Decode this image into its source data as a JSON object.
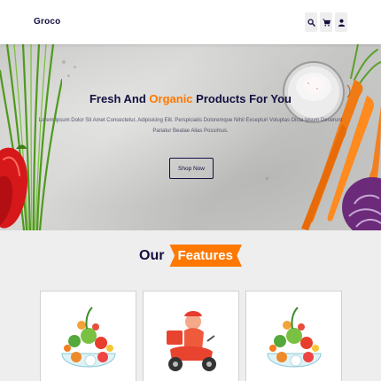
{
  "header": {
    "logo": "Groco",
    "icons": [
      "search-icon",
      "cart-icon",
      "user-icon"
    ]
  },
  "hero": {
    "title_prefix": "Fresh And ",
    "title_accent": "Organic",
    "title_suffix": " Products For You",
    "description": "Lorem Ipsum Dolor Sit Amet Consectetur, Adipisicing Elit. Perspiciatis Doloremque Nihil Excepturi Voluptas Dicta Ipsum Deserunt Pariatur Beatae Alias Possimus.",
    "button_label": "Shop Now"
  },
  "features": {
    "heading_dark": "Our",
    "heading_accent": "Features",
    "cards": [
      {
        "image": "fresh-vegetables-bowl"
      },
      {
        "image": "delivery-scooter"
      },
      {
        "image": "fresh-vegetables-bowl"
      }
    ]
  },
  "colors": {
    "accent": "#ff7800",
    "dark": "#130f40",
    "section_bg": "#eeeeee"
  }
}
